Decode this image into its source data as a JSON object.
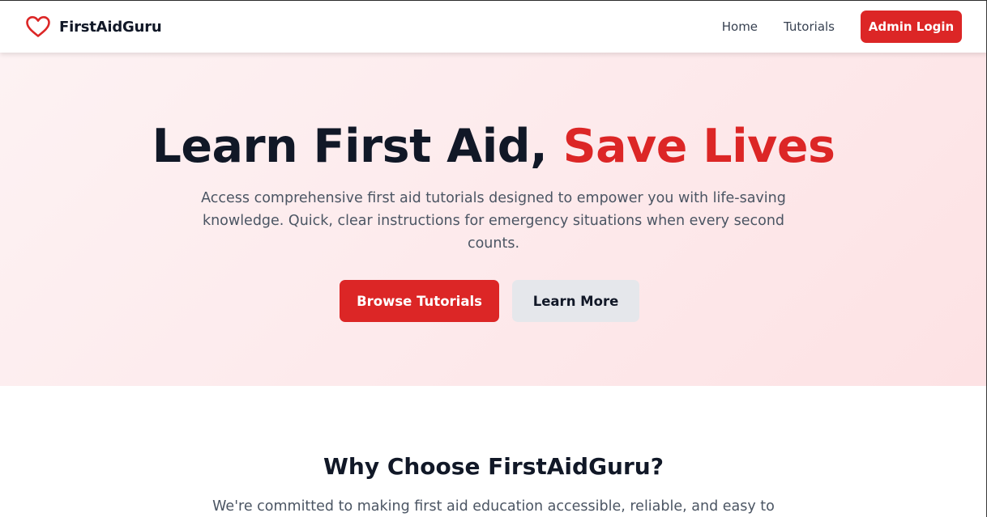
{
  "brand": {
    "name": "FirstAidGuru",
    "icon": "heart-icon",
    "icon_color": "#dc2626"
  },
  "nav": {
    "links": [
      {
        "label": "Home"
      },
      {
        "label": "Tutorials"
      }
    ],
    "admin_button": "Admin Login"
  },
  "hero": {
    "title_main": "Learn First Aid, ",
    "title_accent": "Save Lives",
    "subtitle": "Access comprehensive first aid tutorials designed to empower you with life-saving knowledge. Quick, clear instructions for emergency situations when every second counts.",
    "primary_button": "Browse Tutorials",
    "secondary_button": "Learn More"
  },
  "why": {
    "title": "Why Choose FirstAidGuru?",
    "subtitle": "We're committed to making first aid education accessible, reliable, and easy to"
  },
  "colors": {
    "accent": "#dc2626",
    "hero_background": "#fdeaec",
    "secondary_button": "#e5e7eb",
    "text_dark": "#111827",
    "text_muted": "#4b5563"
  }
}
